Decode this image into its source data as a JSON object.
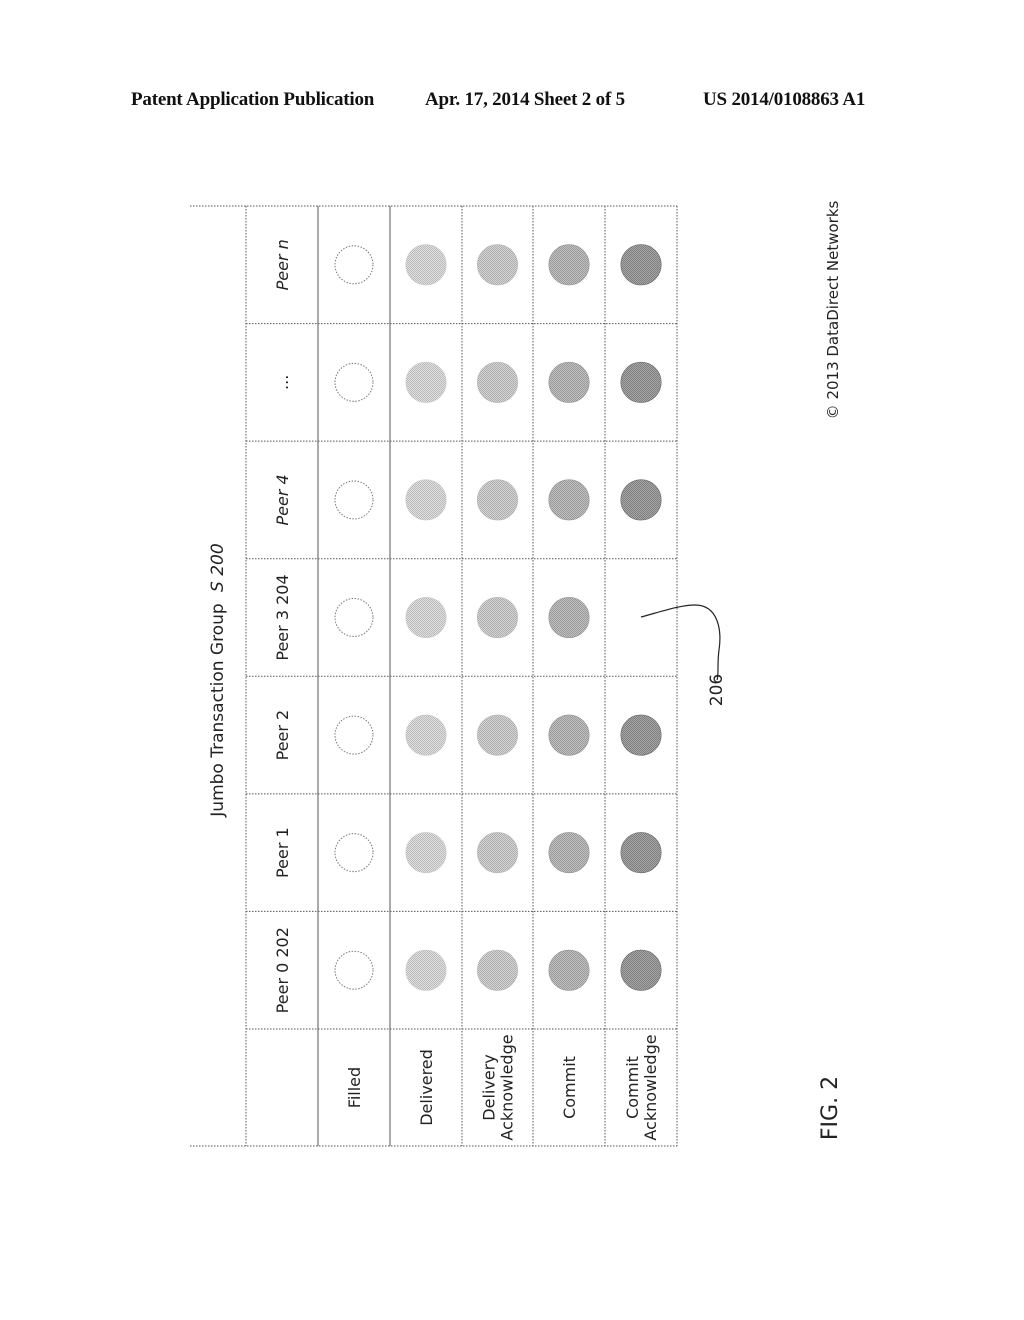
{
  "header": {
    "left": "Patent Application Publication",
    "middle": "Apr. 17, 2014  Sheet 2 of 5",
    "right": "US 2014/0108863 A1"
  },
  "figure": {
    "title": "Jumbo Transaction Group",
    "title_italic": "S 200",
    "row_labels": [
      {
        "lines": [
          "Filled"
        ]
      },
      {
        "lines": [
          "Delivered"
        ]
      },
      {
        "lines": [
          "Delivery",
          "Acknowledge"
        ]
      },
      {
        "lines": [
          "Commit"
        ]
      },
      {
        "lines": [
          "Commit",
          "Acknowledge"
        ]
      }
    ],
    "peers": [
      {
        "label": "Peer 0 202",
        "italic": false,
        "states": [
          true,
          true,
          true,
          true,
          true
        ]
      },
      {
        "label": "Peer 1",
        "italic": false,
        "states": [
          true,
          true,
          true,
          true,
          true
        ]
      },
      {
        "label": "Peer 2",
        "italic": false,
        "states": [
          true,
          true,
          true,
          true,
          true
        ]
      },
      {
        "label": "Peer 3 204",
        "italic": false,
        "states": [
          true,
          true,
          true,
          true,
          false
        ]
      },
      {
        "label": "Peer 4",
        "italic": true,
        "states": [
          true,
          true,
          true,
          true,
          true
        ]
      },
      {
        "label": "...",
        "italic": false,
        "states": [
          true,
          true,
          true,
          true,
          true
        ]
      },
      {
        "label": "Peer n",
        "italic": true,
        "states": [
          true,
          true,
          true,
          true,
          true
        ]
      }
    ],
    "state_colors": [
      "#ffffff",
      "#c8c8c8",
      "#b2b2b2",
      "#8e8e8e",
      "#5e5e5e"
    ],
    "callout_label": "206",
    "fig_label": "FIG. 2",
    "copyright": "© 2013 DataDirect Networks"
  }
}
